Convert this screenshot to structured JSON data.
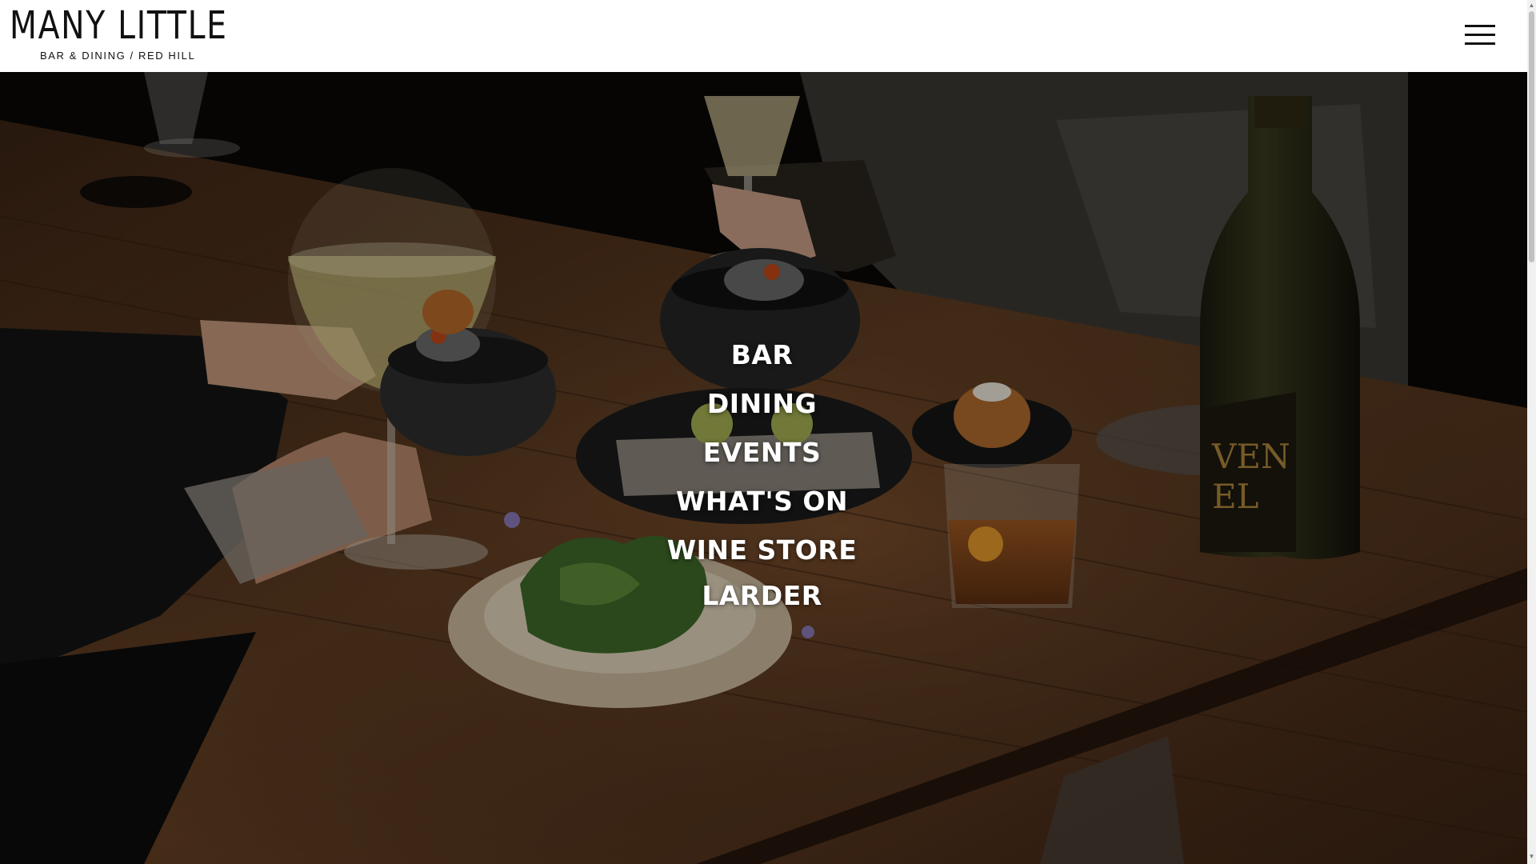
{
  "header": {
    "logo_title": "MANY LITTLE",
    "logo_subtitle": "BAR  &  DINING  /  RED HILL",
    "menu_icon": "hamburger-menu-icon"
  },
  "hero": {
    "image_description_icon": "restaurant-table-photo"
  },
  "nav": {
    "items": [
      {
        "label": "BAR"
      },
      {
        "label": "DINING"
      },
      {
        "label": "EVENTS"
      },
      {
        "label": "WHAT'S ON"
      },
      {
        "label": "WINE STORE"
      },
      {
        "label": "LARDER"
      }
    ]
  },
  "scrollbar": {
    "up_icon": "scroll-up-arrow-icon",
    "down_icon": "scroll-down-arrow-icon"
  },
  "colors": {
    "header_bg": "#ffffff",
    "logo_text": "#111111",
    "nav_text": "#ffffff",
    "table_wood": "#5a3a22"
  }
}
